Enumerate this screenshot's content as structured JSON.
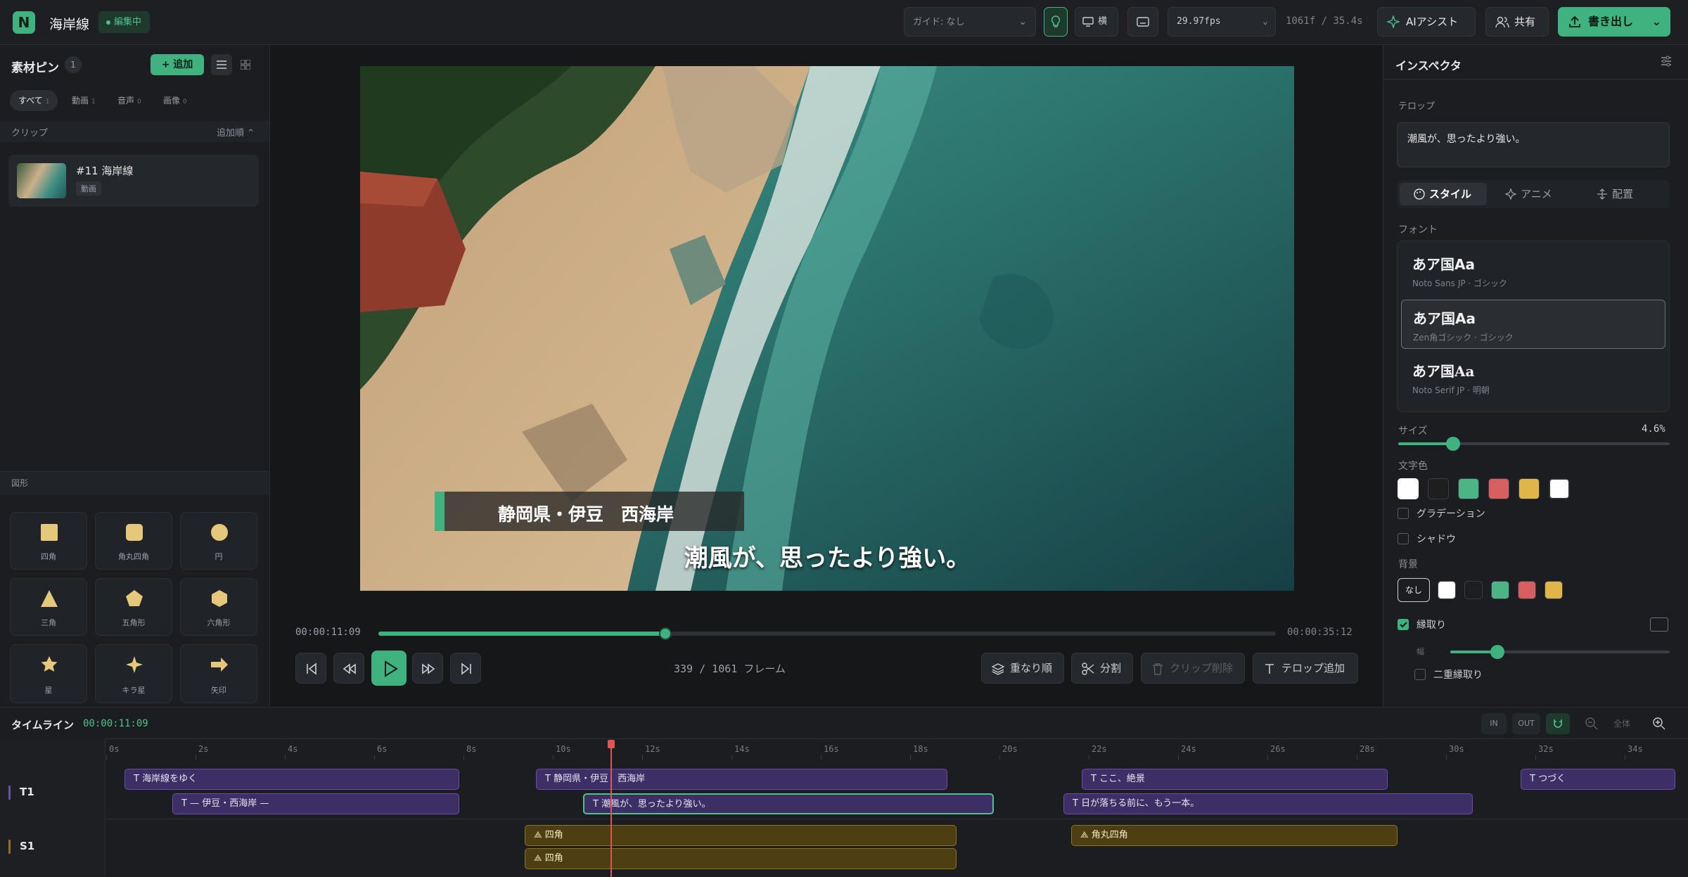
{
  "app": {
    "logo": "N",
    "title": "海岸線",
    "status": "編集中"
  },
  "toolbar": {
    "guide": "ガイド: なし",
    "orientation": "横",
    "fps": "29.97fps",
    "frames_info": "1061f / 35.4s",
    "ai": "AIアシスト",
    "share": "共有",
    "export": "書き出し"
  },
  "bin": {
    "title": "素材ピン",
    "count": "1",
    "add": "+ 追加",
    "filters": [
      {
        "label": "すべて",
        "count": "1"
      },
      {
        "label": "動画",
        "count": "1"
      },
      {
        "label": "音声",
        "count": "0"
      },
      {
        "label": "画像",
        "count": "0"
      }
    ],
    "section": "クリップ",
    "sort": "追加順 ⌃",
    "clip_name": "#11 海岸線",
    "clip_type": "動画"
  },
  "shapes": {
    "title": "図形",
    "items": [
      "四角",
      "角丸四角",
      "円",
      "三角",
      "五角形",
      "六角形",
      "星",
      "キラ星",
      "矢印"
    ]
  },
  "preview": {
    "lower_third": "静岡県・伊豆　西海岸",
    "caption": "潮風が、思ったより強い。",
    "time_current": "00:00:11:09",
    "time_total": "00:00:35:12",
    "progress": 0.32,
    "frame_counter": "339 / 1061 フレーム"
  },
  "actions": {
    "order": "重なり順",
    "split": "分割",
    "delete": "クリップ削除",
    "add_text": "テロップ追加"
  },
  "inspector": {
    "title": "インスペクタ",
    "telop_label": "テロップ",
    "telop_text": "潮風が、思ったより強い。",
    "tabs": [
      "スタイル",
      "アニメ",
      "配置"
    ],
    "font_label": "フォント",
    "fonts": [
      {
        "sample": "あア国Aa",
        "desc": "Noto Sans JP · ゴシック"
      },
      {
        "sample": "あア国Aa",
        "desc": "Zen角ゴシック · ゴシック"
      },
      {
        "sample": "あア国Aa",
        "desc": "Noto Serif JP · 明朝"
      }
    ],
    "size_label": "サイズ",
    "size_value": "4.6%",
    "size_level": 0.2,
    "color_label": "文字色",
    "colors": [
      "#ffffff",
      "#1e1e1e",
      "#4cb585",
      "#d85f5f",
      "#e0b54a",
      "#ffffff"
    ],
    "gradient": "グラデーション",
    "shadow": "シャドウ",
    "bg_label": "背景",
    "bg_none": "なし",
    "bg_colors": [
      "#ffffff",
      "#1e1e1e",
      "#4cb585",
      "#d85f5f",
      "#e0b54a"
    ],
    "outline": "縁取り",
    "outline_width_label": "幅",
    "outline_level": 0.21,
    "double_outline": "二重縁取り"
  },
  "timeline": {
    "title": "タイムライン",
    "time": "00:00:11:09",
    "in": "IN",
    "out": "OUT",
    "fit": "全体",
    "ticks": [
      "0s",
      "2s",
      "4s",
      "6s",
      "8s",
      "10s",
      "12s",
      "14s",
      "16s",
      "18s",
      "20s",
      "22s",
      "24s",
      "26s",
      "28s",
      "30s",
      "32s",
      "34s"
    ],
    "tracks": [
      "T1",
      "S1"
    ],
    "text_clips": [
      "海岸線をゆく",
      "— 伊豆・西海岸 —",
      "静岡県・伊豆　西海岸",
      "潮風が、思ったより強い。",
      "ここ、絶景",
      "日が落ちる前に、もう一本。",
      "つづく"
    ],
    "shape_clips": [
      "四角",
      "四角",
      "角丸四角"
    ]
  }
}
